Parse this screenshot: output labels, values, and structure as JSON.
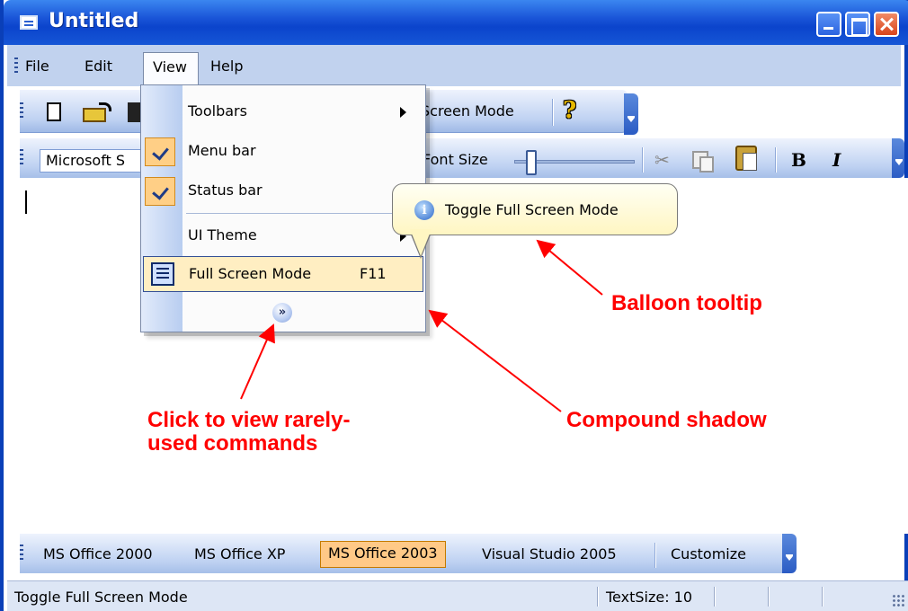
{
  "window": {
    "title": "Untitled"
  },
  "menubar": {
    "items": [
      {
        "label": "File"
      },
      {
        "label": "Edit"
      },
      {
        "label": "View"
      },
      {
        "label": "Help"
      }
    ]
  },
  "toolbar1": {
    "fullscreen_partial": "Screen Mode"
  },
  "toolbar2": {
    "font_name": "Microsoft S",
    "font_size_label": "Font Size",
    "slider_value": 0.1
  },
  "view_menu": {
    "items": [
      {
        "label": "Toolbars",
        "submenu": true
      },
      {
        "label": "Menu bar",
        "checked": true
      },
      {
        "label": "Status bar",
        "checked": true
      },
      {
        "label": "UI Theme",
        "submenu": true
      },
      {
        "label": "Full Screen Mode",
        "shortcut": "F11",
        "highlighted": true
      }
    ],
    "expand_icon": "chevron-double-down-icon"
  },
  "balloon": {
    "text": "Toggle Full Screen Mode"
  },
  "annotations": {
    "balloon": "Balloon tooltip",
    "shadow": "Compound shadow",
    "rare_line1": "Click to view rarely-",
    "rare_line2": "used commands"
  },
  "themes": {
    "items": [
      {
        "label": "MS Office 2000"
      },
      {
        "label": "MS Office XP"
      },
      {
        "label": "MS Office 2003",
        "active": true
      },
      {
        "label": "Visual Studio 2005"
      },
      {
        "label": "Customize"
      }
    ]
  },
  "statusbar": {
    "text": "Toggle Full Screen Mode",
    "textsize": "TextSize: 10"
  },
  "colors": {
    "title_blue": "#0b44cc",
    "menu_highlight": "#ffeec2",
    "theme_active": "#ffc987",
    "annotation": "#ff0000"
  }
}
